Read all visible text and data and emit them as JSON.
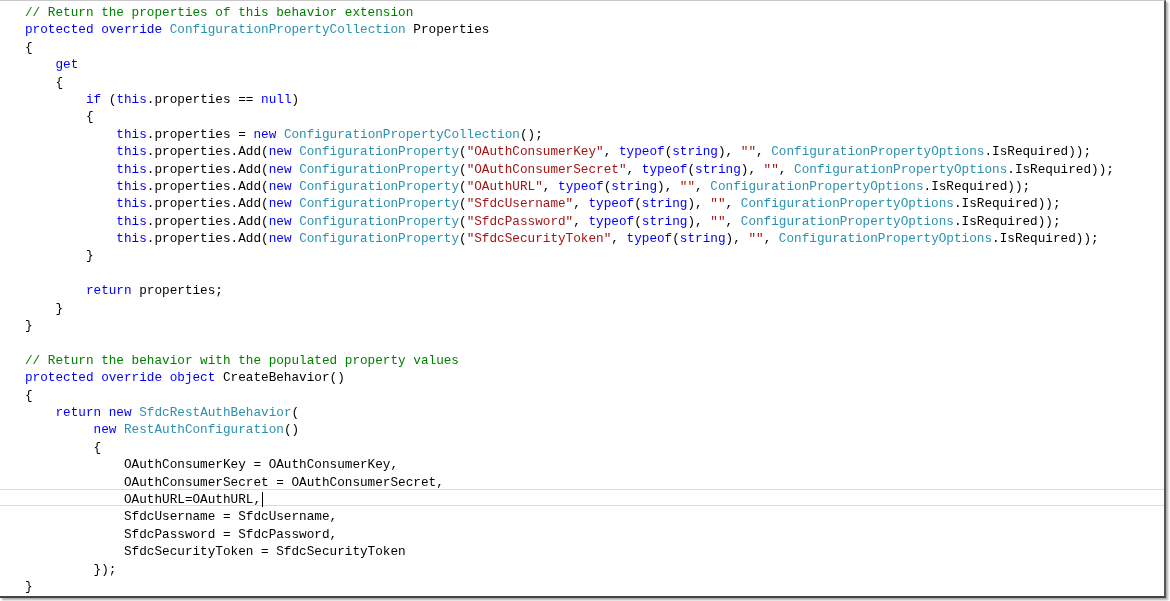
{
  "editor": {
    "lines": [
      {
        "current": false,
        "tokens": [
          {
            "kind": "comment",
            "text": "// Return the properties of this behavior extension"
          }
        ]
      },
      {
        "current": false,
        "tokens": [
          {
            "kind": "keyword",
            "text": "protected override "
          },
          {
            "kind": "type",
            "text": "ConfigurationPropertyCollection"
          },
          {
            "kind": "plain",
            "text": " Properties"
          }
        ]
      },
      {
        "current": false,
        "tokens": [
          {
            "kind": "plain",
            "text": "{"
          }
        ]
      },
      {
        "current": false,
        "tokens": [
          {
            "kind": "keyword",
            "text": "    get"
          }
        ]
      },
      {
        "current": false,
        "tokens": [
          {
            "kind": "plain",
            "text": "    {"
          }
        ]
      },
      {
        "current": false,
        "tokens": [
          {
            "kind": "keyword",
            "text": "        if"
          },
          {
            "kind": "plain",
            "text": " ("
          },
          {
            "kind": "keyword",
            "text": "this"
          },
          {
            "kind": "plain",
            "text": ".properties == "
          },
          {
            "kind": "keyword",
            "text": "null"
          },
          {
            "kind": "plain",
            "text": ")"
          }
        ]
      },
      {
        "current": false,
        "tokens": [
          {
            "kind": "plain",
            "text": "        {"
          }
        ]
      },
      {
        "current": false,
        "tokens": [
          {
            "kind": "keyword",
            "text": "            this"
          },
          {
            "kind": "plain",
            "text": ".properties = "
          },
          {
            "kind": "keyword",
            "text": "new "
          },
          {
            "kind": "type",
            "text": "ConfigurationPropertyCollection"
          },
          {
            "kind": "plain",
            "text": "();"
          }
        ]
      },
      {
        "current": false,
        "tokens": [
          {
            "kind": "keyword",
            "text": "            this"
          },
          {
            "kind": "plain",
            "text": ".properties.Add("
          },
          {
            "kind": "keyword",
            "text": "new "
          },
          {
            "kind": "type",
            "text": "ConfigurationProperty"
          },
          {
            "kind": "plain",
            "text": "("
          },
          {
            "kind": "string",
            "text": "\"OAuthConsumerKey\""
          },
          {
            "kind": "plain",
            "text": ", "
          },
          {
            "kind": "keyword",
            "text": "typeof"
          },
          {
            "kind": "plain",
            "text": "("
          },
          {
            "kind": "keyword",
            "text": "string"
          },
          {
            "kind": "plain",
            "text": "), "
          },
          {
            "kind": "string",
            "text": "\"\""
          },
          {
            "kind": "plain",
            "text": ", "
          },
          {
            "kind": "type",
            "text": "ConfigurationPropertyOptions"
          },
          {
            "kind": "plain",
            "text": ".IsRequired));"
          }
        ]
      },
      {
        "current": false,
        "tokens": [
          {
            "kind": "keyword",
            "text": "            this"
          },
          {
            "kind": "plain",
            "text": ".properties.Add("
          },
          {
            "kind": "keyword",
            "text": "new "
          },
          {
            "kind": "type",
            "text": "ConfigurationProperty"
          },
          {
            "kind": "plain",
            "text": "("
          },
          {
            "kind": "string",
            "text": "\"OAuthConsumerSecret\""
          },
          {
            "kind": "plain",
            "text": ", "
          },
          {
            "kind": "keyword",
            "text": "typeof"
          },
          {
            "kind": "plain",
            "text": "("
          },
          {
            "kind": "keyword",
            "text": "string"
          },
          {
            "kind": "plain",
            "text": "), "
          },
          {
            "kind": "string",
            "text": "\"\""
          },
          {
            "kind": "plain",
            "text": ", "
          },
          {
            "kind": "type",
            "text": "ConfigurationPropertyOptions"
          },
          {
            "kind": "plain",
            "text": ".IsRequired));"
          }
        ]
      },
      {
        "current": false,
        "tokens": [
          {
            "kind": "keyword",
            "text": "            this"
          },
          {
            "kind": "plain",
            "text": ".properties.Add("
          },
          {
            "kind": "keyword",
            "text": "new "
          },
          {
            "kind": "type",
            "text": "ConfigurationProperty"
          },
          {
            "kind": "plain",
            "text": "("
          },
          {
            "kind": "string",
            "text": "\"OAuthURL\""
          },
          {
            "kind": "plain",
            "text": ", "
          },
          {
            "kind": "keyword",
            "text": "typeof"
          },
          {
            "kind": "plain",
            "text": "("
          },
          {
            "kind": "keyword",
            "text": "string"
          },
          {
            "kind": "plain",
            "text": "), "
          },
          {
            "kind": "string",
            "text": "\"\""
          },
          {
            "kind": "plain",
            "text": ", "
          },
          {
            "kind": "type",
            "text": "ConfigurationPropertyOptions"
          },
          {
            "kind": "plain",
            "text": ".IsRequired));"
          }
        ]
      },
      {
        "current": false,
        "tokens": [
          {
            "kind": "keyword",
            "text": "            this"
          },
          {
            "kind": "plain",
            "text": ".properties.Add("
          },
          {
            "kind": "keyword",
            "text": "new "
          },
          {
            "kind": "type",
            "text": "ConfigurationProperty"
          },
          {
            "kind": "plain",
            "text": "("
          },
          {
            "kind": "string",
            "text": "\"SfdcUsername\""
          },
          {
            "kind": "plain",
            "text": ", "
          },
          {
            "kind": "keyword",
            "text": "typeof"
          },
          {
            "kind": "plain",
            "text": "("
          },
          {
            "kind": "keyword",
            "text": "string"
          },
          {
            "kind": "plain",
            "text": "), "
          },
          {
            "kind": "string",
            "text": "\"\""
          },
          {
            "kind": "plain",
            "text": ", "
          },
          {
            "kind": "type",
            "text": "ConfigurationPropertyOptions"
          },
          {
            "kind": "plain",
            "text": ".IsRequired));"
          }
        ]
      },
      {
        "current": false,
        "tokens": [
          {
            "kind": "keyword",
            "text": "            this"
          },
          {
            "kind": "plain",
            "text": ".properties.Add("
          },
          {
            "kind": "keyword",
            "text": "new "
          },
          {
            "kind": "type",
            "text": "ConfigurationProperty"
          },
          {
            "kind": "plain",
            "text": "("
          },
          {
            "kind": "string",
            "text": "\"SfdcPassword\""
          },
          {
            "kind": "plain",
            "text": ", "
          },
          {
            "kind": "keyword",
            "text": "typeof"
          },
          {
            "kind": "plain",
            "text": "("
          },
          {
            "kind": "keyword",
            "text": "string"
          },
          {
            "kind": "plain",
            "text": "), "
          },
          {
            "kind": "string",
            "text": "\"\""
          },
          {
            "kind": "plain",
            "text": ", "
          },
          {
            "kind": "type",
            "text": "ConfigurationPropertyOptions"
          },
          {
            "kind": "plain",
            "text": ".IsRequired));"
          }
        ]
      },
      {
        "current": false,
        "tokens": [
          {
            "kind": "keyword",
            "text": "            this"
          },
          {
            "kind": "plain",
            "text": ".properties.Add("
          },
          {
            "kind": "keyword",
            "text": "new "
          },
          {
            "kind": "type",
            "text": "ConfigurationProperty"
          },
          {
            "kind": "plain",
            "text": "("
          },
          {
            "kind": "string",
            "text": "\"SfdcSecurityToken\""
          },
          {
            "kind": "plain",
            "text": ", "
          },
          {
            "kind": "keyword",
            "text": "typeof"
          },
          {
            "kind": "plain",
            "text": "("
          },
          {
            "kind": "keyword",
            "text": "string"
          },
          {
            "kind": "plain",
            "text": "), "
          },
          {
            "kind": "string",
            "text": "\"\""
          },
          {
            "kind": "plain",
            "text": ", "
          },
          {
            "kind": "type",
            "text": "ConfigurationPropertyOptions"
          },
          {
            "kind": "plain",
            "text": ".IsRequired));"
          }
        ]
      },
      {
        "current": false,
        "tokens": [
          {
            "kind": "plain",
            "text": "        }"
          }
        ]
      },
      {
        "current": false
      },
      {
        "current": false,
        "tokens": [
          {
            "kind": "keyword",
            "text": "        return"
          },
          {
            "kind": "plain",
            "text": " properties;"
          }
        ]
      },
      {
        "current": false,
        "tokens": [
          {
            "kind": "plain",
            "text": "    }"
          }
        ]
      },
      {
        "current": false,
        "tokens": [
          {
            "kind": "plain",
            "text": "}"
          }
        ]
      },
      {
        "current": false
      },
      {
        "current": false,
        "tokens": [
          {
            "kind": "comment",
            "text": "// Return the behavior with the populated property values"
          }
        ]
      },
      {
        "current": false,
        "tokens": [
          {
            "kind": "keyword",
            "text": "protected override object"
          },
          {
            "kind": "plain",
            "text": " CreateBehavior()"
          }
        ]
      },
      {
        "current": false,
        "tokens": [
          {
            "kind": "plain",
            "text": "{"
          }
        ]
      },
      {
        "current": false,
        "tokens": [
          {
            "kind": "keyword",
            "text": "    return new "
          },
          {
            "kind": "type",
            "text": "SfdcRestAuthBehavior"
          },
          {
            "kind": "plain",
            "text": "("
          }
        ]
      },
      {
        "current": false,
        "tokens": [
          {
            "kind": "keyword",
            "text": "         new "
          },
          {
            "kind": "type",
            "text": "RestAuthConfiguration"
          },
          {
            "kind": "plain",
            "text": "()"
          }
        ]
      },
      {
        "current": false,
        "tokens": [
          {
            "kind": "plain",
            "text": "         {"
          }
        ]
      },
      {
        "current": false,
        "tokens": [
          {
            "kind": "plain",
            "text": "             OAuthConsumerKey = OAuthConsumerKey,"
          }
        ]
      },
      {
        "current": false,
        "tokens": [
          {
            "kind": "plain",
            "text": "             OAuthConsumerSecret = OAuthConsumerSecret,"
          }
        ]
      },
      {
        "current": true,
        "tokens": [
          {
            "kind": "plain",
            "text": "             OAuthURL=OAuthURL,"
          }
        ]
      },
      {
        "current": false,
        "tokens": [
          {
            "kind": "plain",
            "text": "             SfdcUsername = SfdcUsername,"
          }
        ]
      },
      {
        "current": false,
        "tokens": [
          {
            "kind": "plain",
            "text": "             SfdcPassword = SfdcPassword,"
          }
        ]
      },
      {
        "current": false,
        "tokens": [
          {
            "kind": "plain",
            "text": "             SfdcSecurityToken = SfdcSecurityToken"
          }
        ]
      },
      {
        "current": false,
        "tokens": [
          {
            "kind": "plain",
            "text": "         });"
          }
        ]
      },
      {
        "current": false,
        "tokens": [
          {
            "kind": "plain",
            "text": "}"
          }
        ]
      }
    ]
  }
}
